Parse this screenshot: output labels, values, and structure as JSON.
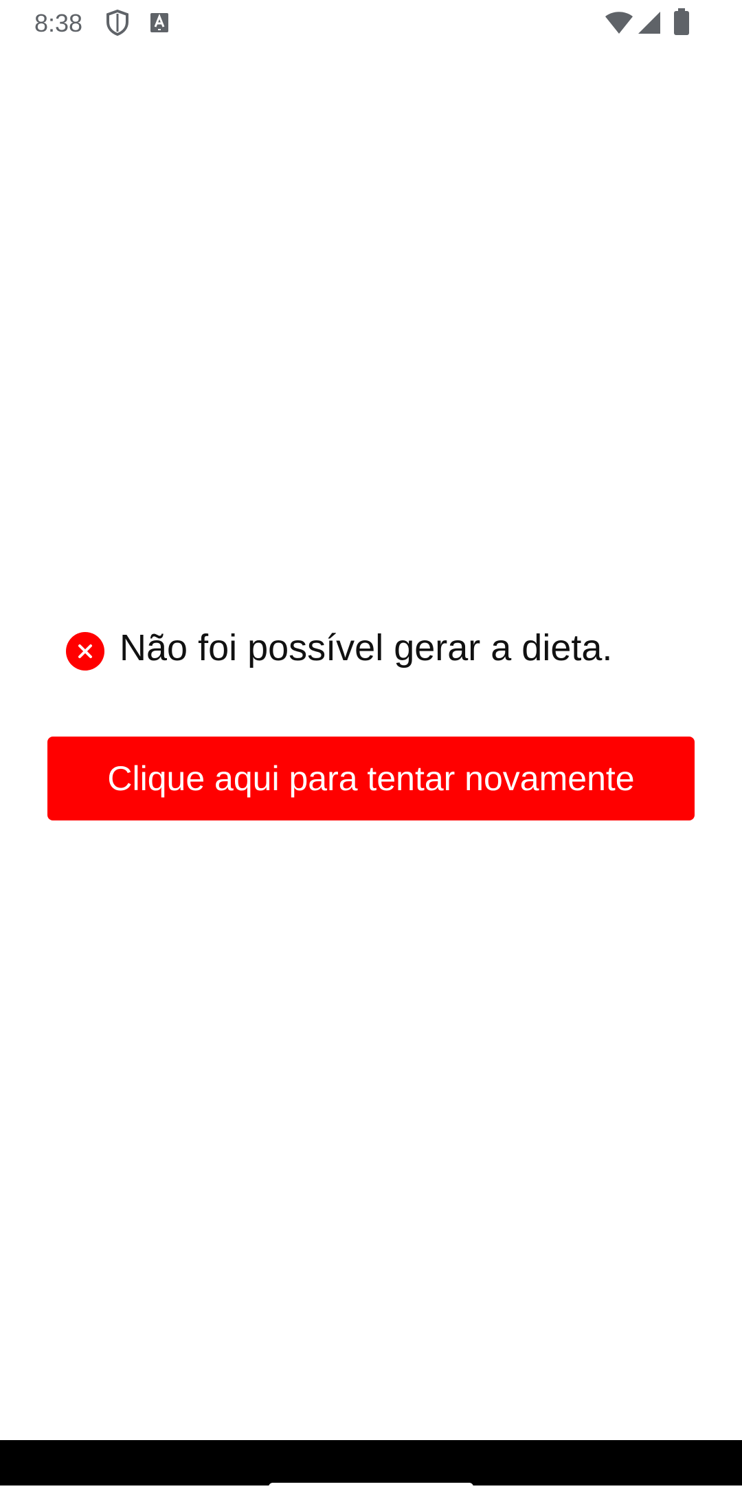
{
  "status_bar": {
    "time": "8:38",
    "icons": [
      "shield-icon",
      "keyboard-a-icon",
      "wifi-icon",
      "signal-icon",
      "battery-icon"
    ]
  },
  "error": {
    "message": "Não foi possível gerar a dieta.",
    "icon": "close-circle-icon",
    "icon_color": "#ff0000"
  },
  "retry_button": {
    "label": "Clique aqui para tentar novamente",
    "color": "#ff0000",
    "text_color": "#ffffff"
  },
  "nav_bar": {
    "color": "#000000",
    "handle": "home-indicator"
  }
}
